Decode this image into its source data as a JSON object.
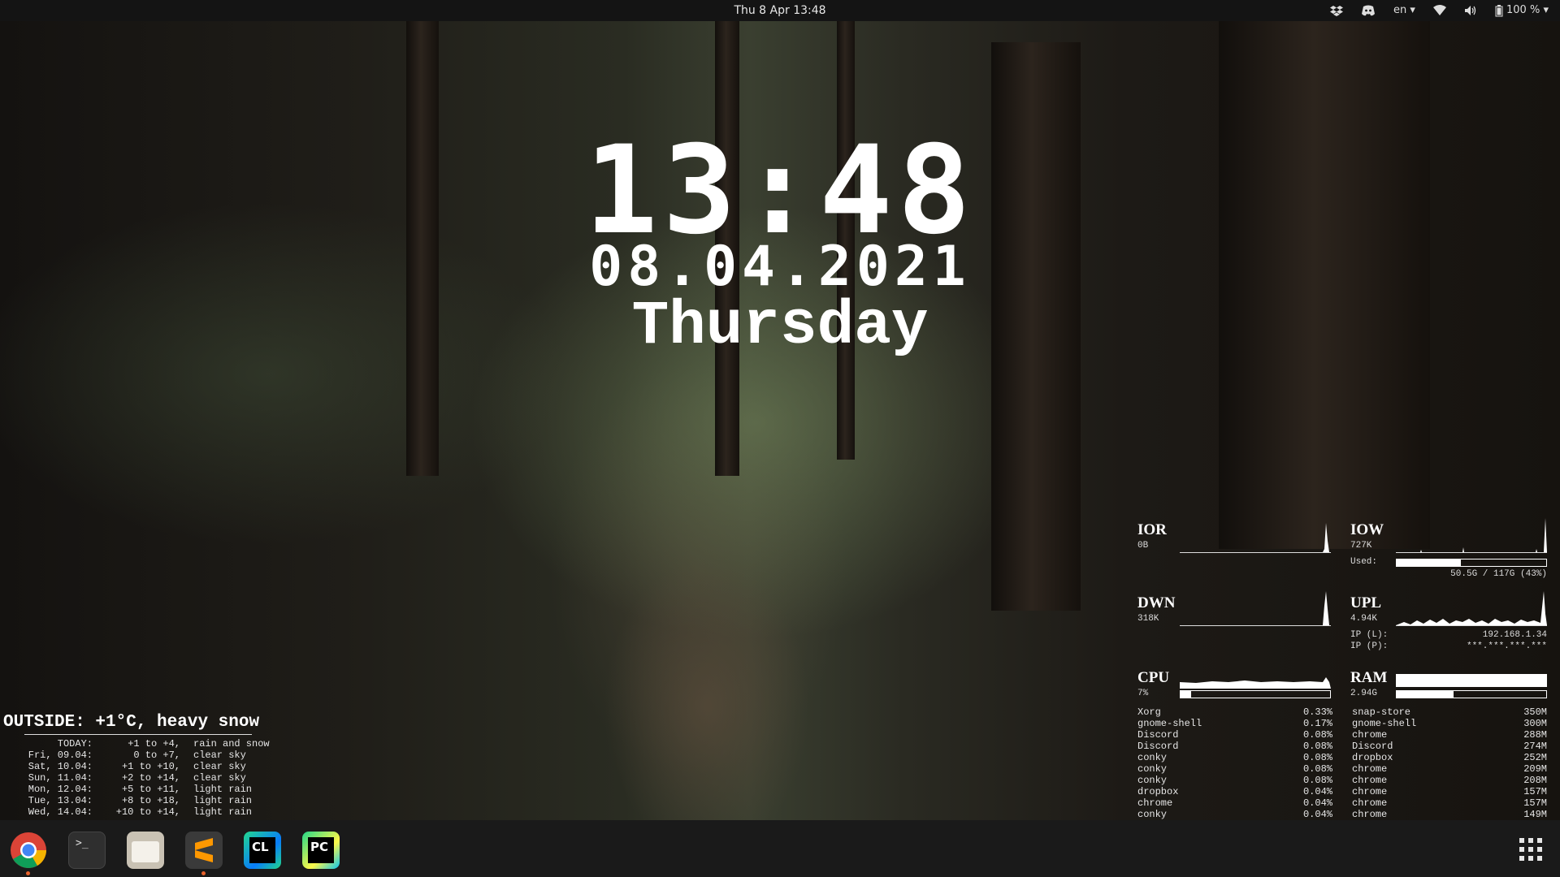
{
  "topbar": {
    "datetime": "Thu 8 Apr  13:48",
    "language": "en",
    "battery": "100 %",
    "icons": [
      "dropbox-icon",
      "discord-icon",
      "wifi-icon",
      "volume-icon",
      "battery-icon"
    ]
  },
  "clock": {
    "time": "13:48",
    "date": "08.04.2021",
    "day": "Thursday"
  },
  "conky": {
    "ior": {
      "label": "IOR",
      "value": "0B"
    },
    "iow": {
      "label": "IOW",
      "value": "727K"
    },
    "disk": {
      "used_label": "Used:",
      "used_text": "50.5G / 117G (43%)",
      "used_fraction": 0.43
    },
    "dwn": {
      "label": "DWN",
      "value": "318K"
    },
    "upl": {
      "label": "UPL",
      "value": "4.94K"
    },
    "ip_local": {
      "label": "IP (L):",
      "value": "192.168.1.34"
    },
    "ip_public": {
      "label": "IP (P):",
      "value": "***.***.***.***"
    },
    "cpu": {
      "label": "CPU",
      "value": "7%",
      "fraction": 0.07
    },
    "ram": {
      "label": "RAM",
      "value": "2.94G",
      "fraction": 0.38
    },
    "cpu_procs": [
      {
        "name": "Xorg",
        "value": "0.33%"
      },
      {
        "name": "gnome-shell",
        "value": "0.17%"
      },
      {
        "name": "Discord",
        "value": "0.08%"
      },
      {
        "name": "Discord",
        "value": "0.08%"
      },
      {
        "name": "conky",
        "value": "0.08%"
      },
      {
        "name": "conky",
        "value": "0.08%"
      },
      {
        "name": "conky",
        "value": "0.08%"
      },
      {
        "name": "dropbox",
        "value": "0.04%"
      },
      {
        "name": "chrome",
        "value": "0.04%"
      },
      {
        "name": "conky",
        "value": "0.04%"
      }
    ],
    "ram_procs": [
      {
        "name": "snap-store",
        "value": "350M"
      },
      {
        "name": "gnome-shell",
        "value": "300M"
      },
      {
        "name": "chrome",
        "value": "288M"
      },
      {
        "name": "Discord",
        "value": "274M"
      },
      {
        "name": "dropbox",
        "value": "252M"
      },
      {
        "name": "chrome",
        "value": "209M"
      },
      {
        "name": "chrome",
        "value": "208M"
      },
      {
        "name": "chrome",
        "value": "157M"
      },
      {
        "name": "chrome",
        "value": "157M"
      },
      {
        "name": "chrome",
        "value": "149M"
      }
    ]
  },
  "weather": {
    "title": "OUTSIDE:   +1°C, heavy snow",
    "rows": [
      {
        "day": "TODAY:",
        "temp": "+1 to +4,",
        "desc": "rain and snow"
      },
      {
        "day": "Fri, 09.04:",
        "temp": "0 to +7,",
        "desc": "clear sky"
      },
      {
        "day": "Sat, 10.04:",
        "temp": "+1 to +10,",
        "desc": "clear sky"
      },
      {
        "day": "Sun, 11.04:",
        "temp": "+2 to +14,",
        "desc": "clear sky"
      },
      {
        "day": "Mon, 12.04:",
        "temp": "+5 to +11,",
        "desc": "light rain"
      },
      {
        "day": "Tue, 13.04:",
        "temp": "+8 to +18,",
        "desc": "light rain"
      },
      {
        "day": "Wed, 14.04:",
        "temp": "+10 to +14,",
        "desc": "light rain"
      }
    ]
  },
  "dock": {
    "apps": [
      {
        "name": "chrome",
        "icon": "chrome-icon",
        "running": true
      },
      {
        "name": "terminal",
        "icon": "terminal-icon",
        "running": false
      },
      {
        "name": "files",
        "icon": "files-icon",
        "running": false
      },
      {
        "name": "sublime-text",
        "icon": "sublime-icon",
        "running": true
      },
      {
        "name": "clion",
        "icon": "clion-icon",
        "running": false
      },
      {
        "name": "pycharm",
        "icon": "pycharm-icon",
        "running": false
      }
    ],
    "grid_icon": "app-grid-icon"
  }
}
